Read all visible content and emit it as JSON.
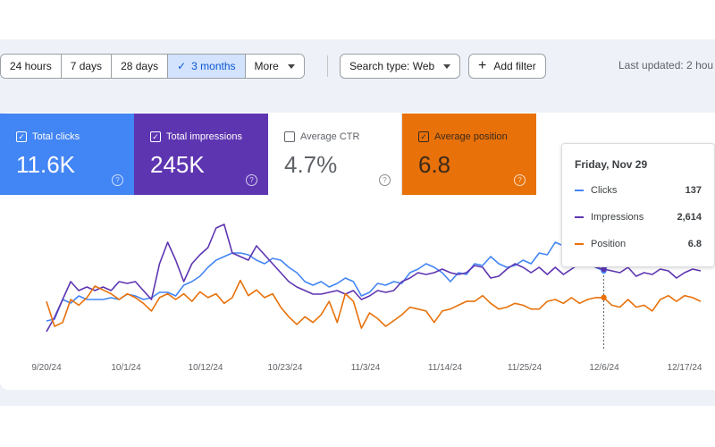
{
  "toolbar": {
    "ranges": [
      "24 hours",
      "7 days",
      "28 days",
      "3 months"
    ],
    "more_label": "More",
    "search_type_label": "Search type: Web",
    "add_filter_label": "Add filter",
    "last_updated": "Last updated: 2 hou"
  },
  "metrics": {
    "clicks": {
      "label": "Total clicks",
      "value": "11.6K",
      "checked": true,
      "color": "#4285f4"
    },
    "impressions": {
      "label": "Total impressions",
      "value": "245K",
      "checked": true,
      "color": "#5e35b1"
    },
    "ctr": {
      "label": "Average CTR",
      "value": "4.7%",
      "checked": false,
      "color": "#ffffff"
    },
    "position": {
      "label": "Average position",
      "value": "6.8",
      "checked": true,
      "color": "#e8710a"
    }
  },
  "tooltip": {
    "date": "Friday, Nov 29",
    "rows": [
      {
        "name": "Clicks",
        "value": "137",
        "color": "#4285f4"
      },
      {
        "name": "Impressions",
        "value": "2,614",
        "color": "#5e35b1"
      },
      {
        "name": "Position",
        "value": "6.8",
        "color": "#e8710a"
      }
    ]
  },
  "chart_data": {
    "type": "line",
    "x_ticks": [
      "9/20/24",
      "10/1/24",
      "10/12/24",
      "10/23/24",
      "11/3/24",
      "11/14/24",
      "11/25/24",
      "12/6/24",
      "12/17/24"
    ],
    "series": [
      {
        "name": "Clicks",
        "color": "#4285f4",
        "values": [
          28,
          29,
          40,
          38,
          42,
          40,
          40,
          40,
          41,
          40,
          43,
          42,
          40,
          41,
          44,
          44,
          42,
          48,
          50,
          53,
          58,
          62,
          64,
          66,
          66,
          65,
          62,
          60,
          63,
          62,
          58,
          55,
          50,
          48,
          50,
          47,
          49,
          52,
          50,
          42,
          44,
          49,
          48,
          50,
          49,
          55,
          57,
          60,
          58,
          55,
          50,
          55,
          54,
          60,
          59,
          64,
          60,
          58,
          59,
          62,
          60,
          66,
          65,
          72,
          70,
          68,
          65,
          60,
          58,
          56,
          62,
          63,
          75,
          70,
          80,
          76,
          73,
          70,
          72,
          68,
          69,
          62
        ]
      },
      {
        "name": "Impressions",
        "color": "#5e35b1",
        "values": [
          22,
          30,
          40,
          50,
          45,
          47,
          45,
          47,
          45,
          50,
          49,
          50,
          45,
          40,
          60,
          72,
          62,
          50,
          60,
          65,
          69,
          80,
          82,
          66,
          64,
          62,
          70,
          65,
          60,
          55,
          50,
          47,
          45,
          43,
          43,
          44,
          45,
          43,
          45,
          40,
          42,
          45,
          44,
          45,
          50,
          52,
          55,
          54,
          55,
          57,
          55,
          54,
          55,
          59,
          58,
          52,
          53,
          57,
          60,
          58,
          55,
          58,
          54,
          58,
          54,
          57,
          60,
          61,
          58,
          57,
          56,
          55,
          58,
          53,
          55,
          54,
          57,
          56,
          52,
          55,
          57,
          56
        ]
      },
      {
        "name": "Position",
        "color": "#e8710a",
        "values": [
          6.5,
          7.8,
          7.6,
          6.4,
          6.7,
          6.3,
          5.7,
          5.9,
          6.1,
          6.4,
          6.1,
          6.3,
          6.6,
          7.0,
          6.3,
          6.1,
          6.4,
          6.1,
          6.5,
          6.0,
          6.3,
          6.1,
          6.6,
          6.3,
          5.4,
          6.2,
          5.9,
          6.3,
          6.1,
          6.8,
          7.3,
          7.7,
          7.3,
          7.6,
          7.2,
          6.5,
          7.6,
          6.1,
          6.5,
          7.9,
          7.1,
          7.4,
          7.8,
          7.5,
          7.2,
          6.8,
          6.9,
          7.0,
          7.6,
          7.0,
          6.9,
          6.7,
          6.5,
          6.5,
          6.2,
          6.6,
          6.9,
          6.8,
          6.6,
          6.7,
          6.9,
          6.9,
          6.5,
          6.4,
          6.6,
          6.3,
          6.6,
          6.4,
          6.3,
          6.3,
          6.7,
          6.8,
          6.4,
          6.8,
          6.7,
          7.0,
          6.4,
          6.2,
          6.5,
          6.2,
          6.3,
          6.5
        ]
      }
    ],
    "highlight_date": "Friday, Nov 29",
    "grid": false
  }
}
